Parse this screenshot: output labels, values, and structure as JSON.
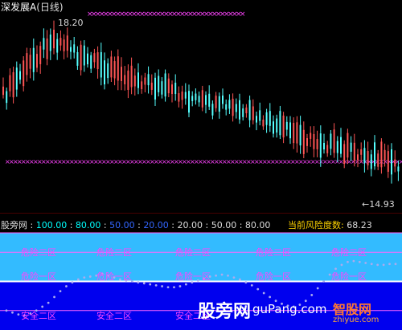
{
  "main_panel": {
    "indicator_name": "深发展A",
    "period": "(日线)",
    "high_label": "18.20",
    "low_label": "←14.93"
  },
  "sub_panel": {
    "indicator_name": "股旁网",
    "levels": [
      {
        "text": "100.00",
        "color": "#00ffff"
      },
      {
        "text": "80.00",
        "color": "#00ffff"
      },
      {
        "text": "50.00",
        "color": "#3366ff"
      },
      {
        "text": "20.00",
        "color": "#3366ff"
      },
      {
        "text": "20.00",
        "color": "#dcdcdc"
      },
      {
        "text": "50.00",
        "color": "#dcdcdc"
      },
      {
        "text": "80.00",
        "color": "#dcdcdc"
      }
    ],
    "risk_label": "当前风险度数:",
    "risk_value": "68.23",
    "zones": {
      "danger_two": "危险二区",
      "danger_one": "危险一区",
      "safe_two": "安全二区"
    }
  },
  "watermark": {
    "site_name": "股旁网",
    "site_url": "guPang.com",
    "logo_cn": "智股网",
    "logo_en": "zhiyue.com"
  },
  "colors": {
    "up_candle": "#ff5555",
    "down_candle": "#55ffff",
    "marker": "#ff44ff",
    "band_cyan": "#33bbff",
    "band_blue": "#0000ee",
    "risk_line": "#aaaaee",
    "zone_text": "#ff44ff",
    "title_accent": "#ffd400"
  },
  "chart_data": {
    "type": "line",
    "series": [
      {
        "values": [
          20,
          18,
          16,
          15,
          17,
          20,
          24,
          28,
          34,
          40,
          45,
          49,
          52,
          54,
          55,
          56,
          58,
          56,
          54,
          52,
          51,
          50,
          49,
          48,
          47,
          46,
          45,
          44,
          44,
          45,
          47,
          49,
          51,
          53,
          55,
          56,
          57,
          56,
          54,
          52,
          49,
          46,
          42,
          38,
          34,
          30,
          27,
          25,
          24,
          26,
          30,
          36,
          43,
          50,
          57,
          63,
          67,
          70,
          71,
          70,
          69,
          68,
          67,
          67,
          68,
          68
        ]
      }
    ],
    "ylim": [
      0,
      100
    ],
    "reference_levels": [
      20,
      50,
      80,
      100
    ]
  }
}
